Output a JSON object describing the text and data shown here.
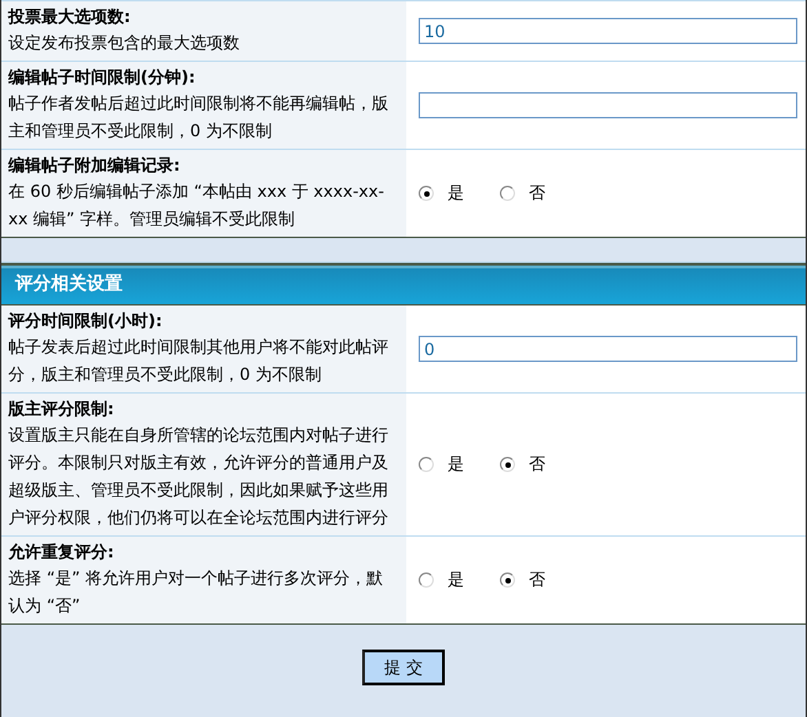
{
  "sections": [
    {
      "rows": [
        {
          "kind": "text",
          "label": "投票最大选项数:",
          "description": "设定发布投票包含的最大选项数",
          "value": "10"
        },
        {
          "kind": "text",
          "label": "编辑帖子时间限制(分钟):",
          "description": "帖子作者发帖后超过此时间限制将不能再编辑帖，版主和管理员不受此限制，0 为不限制",
          "value": ""
        },
        {
          "kind": "radio",
          "label": "编辑帖子附加编辑记录:",
          "description": "在 60 秒后编辑帖子添加 “本帖由 xxx 于 xxxx-xx-xx 编辑” 字样。管理员编辑不受此限制",
          "options": [
            {
              "label": "是",
              "selected": true
            },
            {
              "label": "否",
              "selected": false
            }
          ]
        }
      ]
    },
    {
      "title": "评分相关设置",
      "rows": [
        {
          "kind": "text",
          "label": "评分时间限制(小时):",
          "description": "帖子发表后超过此时间限制其他用户将不能对此帖评分，版主和管理员不受此限制，0 为不限制",
          "value": "0"
        },
        {
          "kind": "radio",
          "label": "版主评分限制:",
          "description": "设置版主只能在自身所管辖的论坛范围内对帖子进行评分。本限制只对版主有效，允许评分的普通用户及超级版主、管理员不受此限制，因此如果赋予这些用户评分权限，他们仍将可以在全论坛范围内进行评分",
          "options": [
            {
              "label": "是",
              "selected": false
            },
            {
              "label": "否",
              "selected": true
            }
          ]
        },
        {
          "kind": "radio",
          "label": "允许重复评分:",
          "description": "选择 “是” 将允许用户对一个帖子进行多次评分，默认为 “否”",
          "options": [
            {
              "label": "是",
              "selected": false
            },
            {
              "label": "否",
              "selected": true
            }
          ]
        }
      ]
    }
  ],
  "submit": "提 交"
}
